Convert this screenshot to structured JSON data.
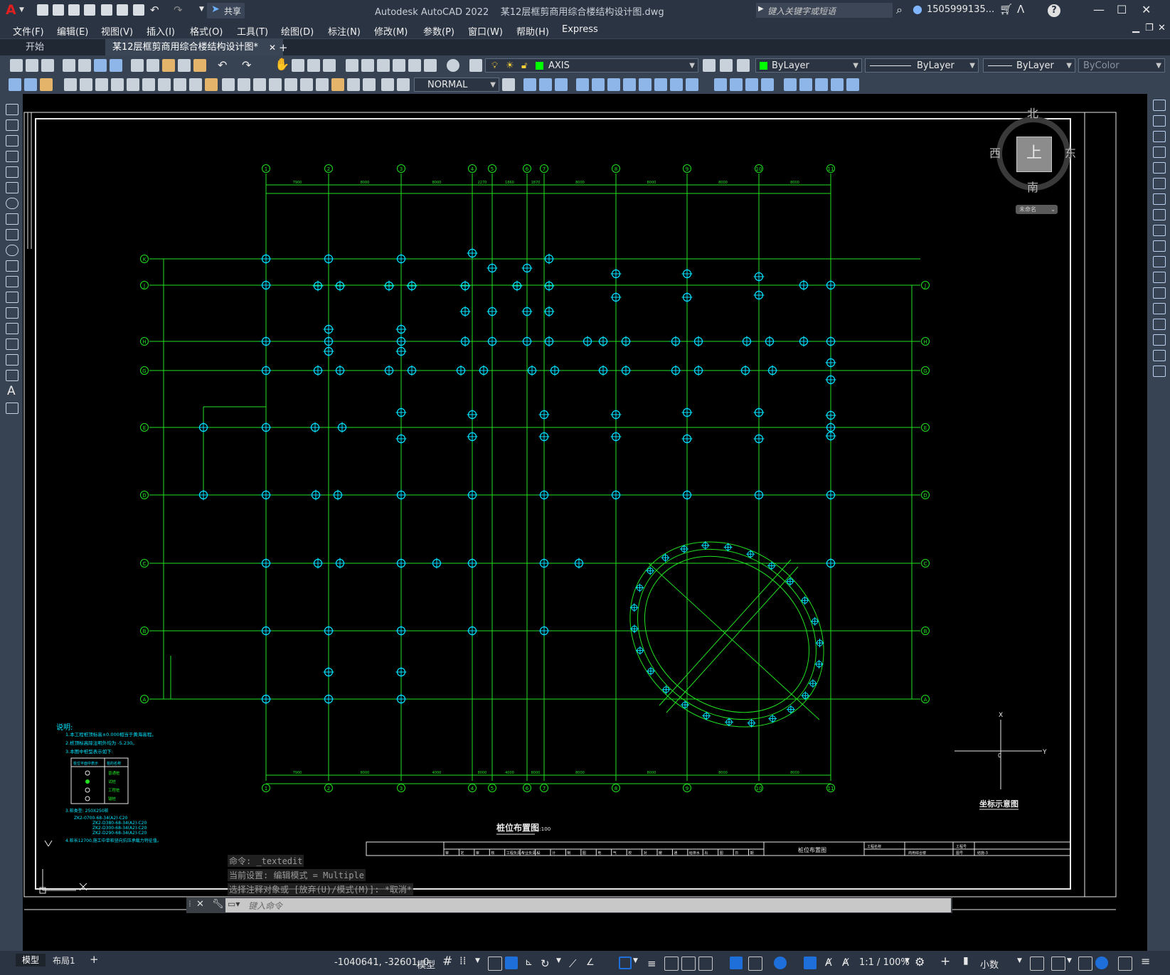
{
  "app": {
    "title": "Autodesk AutoCAD 2022    某12层框剪商用综合楼结构设计图.dwg",
    "logo": "A",
    "share_label": "共享",
    "search_placeholder": "键入关键字或短语",
    "user": "1505999135...",
    "help_icon": "?"
  },
  "menu": [
    "文件(F)",
    "编辑(E)",
    "视图(V)",
    "插入(I)",
    "格式(O)",
    "工具(T)",
    "绘图(D)",
    "标注(N)",
    "修改(M)",
    "参数(P)",
    "窗口(W)",
    "帮助(H)",
    "Express"
  ],
  "tabs": {
    "start": "开始",
    "active": "某12层框剪商用综合楼结构设计图*",
    "close": "✕",
    "add": "+"
  },
  "toolbar": {
    "layer_name": "AXIS",
    "color": "ByLayer",
    "linetype": "ByLayer",
    "lineweight": "ByLayer",
    "plotstyle": "ByColor",
    "text_style": "NORMAL"
  },
  "viewcube": {
    "north": "北",
    "south": "南",
    "east": "东",
    "west": "西",
    "top": "上",
    "wcs": "未命名"
  },
  "drawing": {
    "grid_x_labels": [
      "1",
      "2",
      "3",
      "4",
      "5",
      "6",
      "7",
      "8",
      "9",
      "10",
      "11"
    ],
    "grid_y_labels": [
      "K",
      "J",
      "H",
      "G",
      "E",
      "D",
      "C",
      "B",
      "A"
    ],
    "title": "桩位布置图",
    "scale": "1:100",
    "coord_title": "坐标示意图",
    "axis_x": "X",
    "axis_y": "Y",
    "axis_o": "0",
    "notes_title": "说明:",
    "notes": [
      "1.本工程桩顶标高±0.000相当于黄海高程。",
      "2.桩顶标高除注明外均为 -5.230。",
      "3.本图中桩型表示如下:"
    ],
    "legend_header": [
      "桩位平面中表示",
      "桩的名称"
    ],
    "legend_rows": [
      "普通桩",
      "试桩",
      "工程桩",
      "锚桩"
    ],
    "pile_notes": [
      "3.桩类型: 250X250桩",
      "ZK2-0700-68-34(A2)-C20",
      "ZK2-D380-68-34(A2)-C20",
      "ZK2-D300-68-34(A2)-C20",
      "ZK2-D290-68-34(A2)-C20",
      "4.桩长12700,施工中单桩竖向抗压承载力特征值。"
    ],
    "titleblock_label": "桩位布置图",
    "titleblock_heads": [
      "审",
      "定",
      "审",
      "核",
      "工程负责人",
      "专业负责人",
      "设",
      "计",
      "制",
      "图",
      "电",
      "气",
      "校",
      "对",
      "暖",
      "通",
      "给排水",
      "出",
      "图",
      "日",
      "期"
    ],
    "titleblock_right": [
      "工程名称",
      "商用综合楼",
      "工程号",
      "图号",
      "结施-3"
    ],
    "dims_top": [
      "7900",
      "8000",
      "8000",
      "2270",
      "1860",
      "1870",
      "8000",
      "8000",
      "8000",
      "8000"
    ],
    "dims_bottom": [
      "7900",
      "8000",
      "4000",
      "8000",
      "4000",
      "8000",
      "8000",
      "8000",
      "8000",
      "8000"
    ]
  },
  "command": {
    "history": [
      "命令: _textedit",
      "当前设置: 编辑模式 = Multiple",
      "选择注释对象或 [放弃(U)/模式(M)]: *取消*"
    ],
    "placeholder": "键入命令"
  },
  "status": {
    "model_tab": "模型",
    "layout_tab": "布局1",
    "add_tab": "+",
    "coords": "-1040641, -32601, 0",
    "model_label": "模型",
    "scale": "1:1 / 100%",
    "units": "小数"
  },
  "colors": {
    "grid": "#22e022",
    "pile": "#00e5ff",
    "bg": "#000000",
    "accent": "#1e6fd9"
  }
}
